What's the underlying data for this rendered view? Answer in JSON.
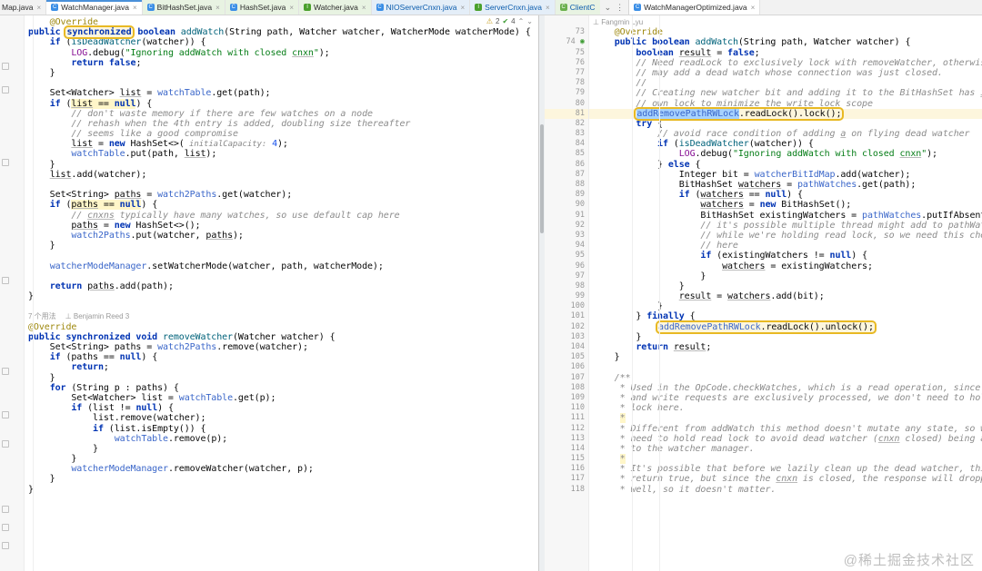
{
  "tabbar": {
    "tabs": [
      {
        "label": "Map.java",
        "icon": "java-class-icon",
        "style": "plain",
        "truncated": true
      },
      {
        "label": "WatchManager.java",
        "icon": "java-class-icon",
        "style": "selected"
      },
      {
        "label": "BitHashSet.java",
        "icon": "java-class-icon",
        "style": "green"
      },
      {
        "label": "HashSet.java",
        "icon": "java-class-icon",
        "style": "green"
      },
      {
        "label": "Watcher.java",
        "icon": "java-interface-icon",
        "style": "green"
      },
      {
        "label": "NIOServerCnxn.java",
        "icon": "java-class-icon",
        "style": "blue-dirty"
      },
      {
        "label": "ServerCnxn.java",
        "icon": "java-interface-icon",
        "style": "blue-dirty"
      },
      {
        "label": "ClientC",
        "icon": "java-class-icon",
        "style": "green-dirty"
      }
    ],
    "overflow_icon": "chevron-down-icon",
    "more_icon": "more-vertical-icon",
    "right_tab": {
      "label": "WatchManagerOptimized.java",
      "icon": "java-class-icon"
    }
  },
  "inspection": {
    "warning_icon": "warning-triangle-icon",
    "warning_count": "2",
    "ok_icon": "check-icon",
    "ok_count": "4",
    "prev_icon": "chevron-up-icon",
    "next_icon": "chevron-down-icon"
  },
  "left_editor": {
    "name": "WatchManager.java",
    "selection": "synchronized",
    "codelens": {
      "usages": "7 个用法",
      "author": "Benjamin Reed 3",
      "author_icon": "person-icon"
    },
    "lines": [
      {
        "t": "    @Override",
        "k": "an"
      },
      {
        "t": "public synchronized boolean addWatch(String path, Watcher watcher, WatcherMode watcherMode) {",
        "k": "sig"
      },
      {
        "t": "    if (isDeadWatcher(watcher)) {"
      },
      {
        "t": "        LOG.debug(\"Ignoring addWatch with closed cnxn\");"
      },
      {
        "t": "        return false;"
      },
      {
        "t": "    }"
      },
      {
        "t": ""
      },
      {
        "t": "    Set<Watcher> list = watchTable.get(path);"
      },
      {
        "t": "    if (list == null) {",
        "hl": true
      },
      {
        "t": "        // don't waste memory if there are few watches on a node"
      },
      {
        "t": "        // rehash when the 4th entry is added, doubling size thereafter"
      },
      {
        "t": "        // seems like a good compromise"
      },
      {
        "t": "        list = new HashSet<>( initialCapacity: 4);"
      },
      {
        "t": "        watchTable.put(path, list);"
      },
      {
        "t": "    }"
      },
      {
        "t": "    list.add(watcher);"
      },
      {
        "t": ""
      },
      {
        "t": "    Set<String> paths = watch2Paths.get(watcher);"
      },
      {
        "t": "    if (paths == null) {",
        "hl": true
      },
      {
        "t": "        // cnxns typically have many watches, so use default cap here"
      },
      {
        "t": "        paths = new HashSet<>();"
      },
      {
        "t": "        watch2Paths.put(watcher, paths);"
      },
      {
        "t": "    }"
      },
      {
        "t": ""
      },
      {
        "t": "    watcherModeManager.setWatcherMode(watcher, path, watcherMode);"
      },
      {
        "t": ""
      },
      {
        "t": "    return paths.add(path);"
      },
      {
        "t": "}"
      },
      {
        "t": ""
      },
      {
        "t": "CODELENS"
      },
      {
        "t": "@Override"
      },
      {
        "t": "public synchronized void removeWatcher(Watcher watcher) {"
      },
      {
        "t": "    Set<String> paths = watch2Paths.remove(watcher);"
      },
      {
        "t": "    if (paths == null) {"
      },
      {
        "t": "        return;"
      },
      {
        "t": "    }"
      },
      {
        "t": "    for (String p : paths) {"
      },
      {
        "t": "        Set<Watcher> list = watchTable.get(p);"
      },
      {
        "t": "        if (list != null) {"
      },
      {
        "t": "            list.remove(watcher);"
      },
      {
        "t": "            if (list.isEmpty()) {"
      },
      {
        "t": "                watchTable.remove(p);"
      },
      {
        "t": "            }"
      },
      {
        "t": "        }"
      },
      {
        "t": "        watcherModeManager.removeWatcher(watcher, p);"
      },
      {
        "t": "    }"
      },
      {
        "t": "}"
      }
    ]
  },
  "right_editor": {
    "name": "WatchManagerOptimized.java",
    "author_line": "Fangmin Lyu",
    "author_icon": "person-icon",
    "first_line_number": 73,
    "highlighted_line": 81,
    "boxed_lines": [
      81,
      102
    ],
    "selection": "addRemovePathRWLock",
    "lines": [
      {
        "n": 73,
        "t": "    @Override"
      },
      {
        "n": 74,
        "t": "    public boolean addWatch(String path, Watcher watcher) {",
        "mark": "override-gutter-icon"
      },
      {
        "n": 75,
        "t": "        boolean result = false;"
      },
      {
        "n": 76,
        "t": "        // Need readLock to exclusively lock with removeWatcher, otherwise we"
      },
      {
        "n": 77,
        "t": "        // may add a dead watch whose connection was just closed."
      },
      {
        "n": 78,
        "t": "        //"
      },
      {
        "n": 79,
        "t": "        // Creating new watcher bit and adding it to the BitHashSet has it's"
      },
      {
        "n": 80,
        "t": "        // own lock to minimize the write lock scope"
      },
      {
        "n": 81,
        "t": "        addRemovePathRWLock.readLock().lock();",
        "box": true,
        "hl": true
      },
      {
        "n": 82,
        "t": "        try {"
      },
      {
        "n": 83,
        "t": "            // avoid race condition of adding a on flying dead watcher"
      },
      {
        "n": 84,
        "t": "            if (isDeadWatcher(watcher)) {"
      },
      {
        "n": 85,
        "t": "                LOG.debug(\"Ignoring addWatch with closed cnxn\");"
      },
      {
        "n": 86,
        "t": "            } else {"
      },
      {
        "n": 87,
        "t": "                Integer bit = watcherBitIdMap.add(watcher);"
      },
      {
        "n": 88,
        "t": "                BitHashSet watchers = pathWatches.get(path);"
      },
      {
        "n": 89,
        "t": "                if (watchers == null) {"
      },
      {
        "n": 90,
        "t": "                    watchers = new BitHashSet();"
      },
      {
        "n": 91,
        "t": "                    BitHashSet existingWatchers = pathWatches.putIfAbsent(path, watchers);"
      },
      {
        "n": 92,
        "t": "                    // it's possible multiple thread might add to pathWatches"
      },
      {
        "n": 93,
        "t": "                    // while we're holding read lock, so we need this check"
      },
      {
        "n": 94,
        "t": "                    // here"
      },
      {
        "n": 95,
        "t": "                    if (existingWatchers != null) {"
      },
      {
        "n": 96,
        "t": "                        watchers = existingWatchers;"
      },
      {
        "n": 97,
        "t": "                    }"
      },
      {
        "n": 98,
        "t": "                }"
      },
      {
        "n": 99,
        "t": "                result = watchers.add(bit);"
      },
      {
        "n": 100,
        "t": "            }"
      },
      {
        "n": 101,
        "t": "        } finally {"
      },
      {
        "n": 102,
        "t": "            addRemovePathRWLock.readLock().unlock();",
        "box": true
      },
      {
        "n": 103,
        "t": "        }"
      },
      {
        "n": 104,
        "t": "        return result;"
      },
      {
        "n": 105,
        "t": "    }"
      },
      {
        "n": 106,
        "t": ""
      },
      {
        "n": 107,
        "t": "    /**"
      },
      {
        "n": 108,
        "t": "     * Used in the OpCode.checkWatches, which is a read operation, since read"
      },
      {
        "n": 109,
        "t": "     * and write requests are exclusively processed, we don't need to hold"
      },
      {
        "n": 110,
        "t": "     * lock here."
      },
      {
        "n": 111,
        "t": "     *"
      },
      {
        "n": 112,
        "t": "     * Different from addWatch this method doesn't mutate any state, so we don't"
      },
      {
        "n": 113,
        "t": "     * need to hold read lock to avoid dead watcher (cnxn closed) being added"
      },
      {
        "n": 114,
        "t": "     * to the watcher manager."
      },
      {
        "n": 115,
        "t": "     *"
      },
      {
        "n": 116,
        "t": "     * It's possible that before we lazily clean up the dead watcher, this will"
      },
      {
        "n": 117,
        "t": "     * return true, but since the cnxn is closed, the response will dropped as"
      },
      {
        "n": 118,
        "t": "     * well, so it doesn't matter."
      }
    ]
  },
  "watermark": {
    "text": "@稀土掘金技术社区"
  },
  "colors": {
    "keyword": "#0033b3",
    "string": "#067d17",
    "comment": "#8c8c8c",
    "field": "#871094",
    "annotation": "#9e880d",
    "highlight": "#fdf6dd",
    "box_border": "#e8b923",
    "selection": "#a6d2ff",
    "accent": "#4a90d9"
  }
}
